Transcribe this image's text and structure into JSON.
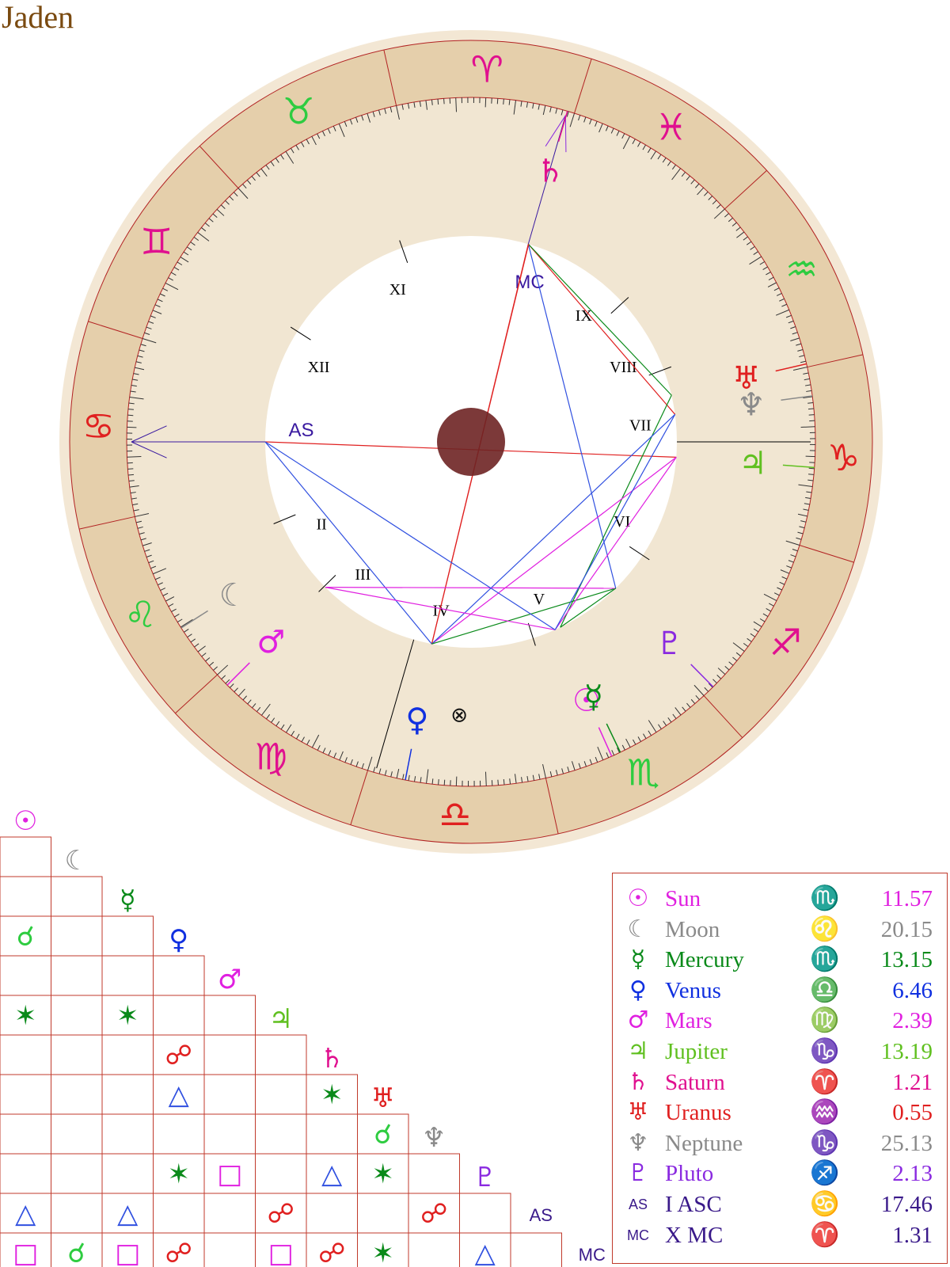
{
  "title": "Jaden",
  "wheel": {
    "asc_longitude": 107.46,
    "mc_longitude": 1.31,
    "ring_outer_color": "#f3e7d4",
    "zodiac_band_color": "#e5cfab",
    "inner_ring_color": "#f1e6d2",
    "line_color": "#b22222",
    "center_dot_color": "#6e2424",
    "signs": [
      {
        "glyph": "♈",
        "color": "#e0108f"
      },
      {
        "glyph": "♉",
        "color": "#2ecc40"
      },
      {
        "glyph": "♊",
        "color": "#e0108f"
      },
      {
        "glyph": "♋",
        "color": "#e02020"
      },
      {
        "glyph": "♌",
        "color": "#2ecc40"
      },
      {
        "glyph": "♍",
        "color": "#e0108f"
      },
      {
        "glyph": "♎",
        "color": "#e02020"
      },
      {
        "glyph": "♏",
        "color": "#2ecc40"
      },
      {
        "glyph": "♐",
        "color": "#e0108f"
      },
      {
        "glyph": "♑",
        "color": "#e02020"
      },
      {
        "glyph": "♒",
        "color": "#2ecc40"
      },
      {
        "glyph": "♓",
        "color": "#e0108f"
      }
    ],
    "houses": [
      {
        "label": "AS",
        "lon": 107.46,
        "color": "#3a1aa0"
      },
      {
        "label": "II",
        "lon": 130,
        "color": "#000000"
      },
      {
        "label": "III",
        "lon": 152,
        "color": "#000000"
      },
      {
        "label": "IV",
        "lon": 181.31,
        "color": "#000000"
      },
      {
        "label": "V",
        "lon": 215,
        "color": "#000000"
      },
      {
        "label": "VI",
        "lon": 254,
        "color": "#000000"
      },
      {
        "label": "VII",
        "lon": 287.46,
        "color": "#000000"
      },
      {
        "label": "VIII",
        "lon": 308,
        "color": "#000000"
      },
      {
        "label": "IX",
        "lon": 330,
        "color": "#000000"
      },
      {
        "label": "MC",
        "lon": 1.31,
        "color": "#3a1aa0"
      },
      {
        "label": "XI",
        "lon": 37,
        "color": "#000000"
      },
      {
        "label": "XII",
        "lon": 75,
        "color": "#000000"
      }
    ],
    "part_of_fortune": {
      "glyph": "⊗",
      "lon": 195
    }
  },
  "planets": [
    {
      "key": "sun",
      "glyph": "☉",
      "name": "Sun",
      "sign_glyph": "♏",
      "degree": "11.57",
      "lon": 221.57,
      "color": "#e020e0"
    },
    {
      "key": "moon",
      "glyph": "☾",
      "name": "Moon",
      "sign_glyph": "♌",
      "degree": "20.15",
      "lon": 140.15,
      "color": "#8a8a8a"
    },
    {
      "key": "mercury",
      "glyph": "☿",
      "name": "Mercury",
      "sign_glyph": "♏",
      "degree": "13.15",
      "lon": 223.15,
      "color": "#0a8a1a"
    },
    {
      "key": "venus",
      "glyph": "♀",
      "name": "Venus",
      "sign_glyph": "♎",
      "degree": "6.46",
      "lon": 186.46,
      "color": "#1030e0"
    },
    {
      "key": "mars",
      "glyph": "♂",
      "name": "Mars",
      "sign_glyph": "♍",
      "degree": "2.39",
      "lon": 152.39,
      "color": "#e020e0"
    },
    {
      "key": "jupiter",
      "glyph": "♃",
      "name": "Jupiter",
      "sign_glyph": "♑",
      "degree": "13.19",
      "lon": 283.19,
      "color": "#60c020"
    },
    {
      "key": "saturn",
      "glyph": "♄",
      "name": "Saturn",
      "sign_glyph": "♈",
      "degree": "1.21",
      "lon": 1.21,
      "color": "#e0108f"
    },
    {
      "key": "uranus",
      "glyph": "♅",
      "name": "Uranus",
      "sign_glyph": "♒",
      "degree": "0.55",
      "lon": 300.55,
      "color": "#e02020"
    },
    {
      "key": "neptune",
      "glyph": "♆",
      "name": "Neptune",
      "sign_glyph": "♑",
      "degree": "25.13",
      "lon": 295.13,
      "color": "#8a8a8a"
    },
    {
      "key": "pluto",
      "glyph": "♇",
      "name": "Pluto",
      "sign_glyph": "♐",
      "degree": "2.13",
      "lon": 242.13,
      "color": "#8a2ae0"
    },
    {
      "key": "asc",
      "glyph": "AS",
      "name": "I ASC",
      "sign_glyph": "♋",
      "degree": "17.46",
      "lon": 107.46,
      "color": "#3a1a8a"
    },
    {
      "key": "mc",
      "glyph": "MC",
      "name": "X MC",
      "sign_glyph": "♈",
      "degree": "1.31",
      "lon": 1.31,
      "color": "#3a1a8a"
    }
  ],
  "aspect_lines": [
    {
      "from": "asc",
      "to": "venus",
      "color": "#3050e0"
    },
    {
      "from": "asc",
      "to": "jupiter",
      "color": "#e02020"
    },
    {
      "from": "mc",
      "to": "venus",
      "color": "#e02020"
    },
    {
      "from": "mc",
      "to": "neptune",
      "color": "#e02020"
    },
    {
      "from": "mc",
      "to": "pluto",
      "color": "#3050e0"
    },
    {
      "from": "mc",
      "to": "uranus",
      "color": "#0a8a1a"
    },
    {
      "from": "saturn",
      "to": "venus",
      "color": "#e02020"
    },
    {
      "from": "uranus",
      "to": "mercury",
      "color": "#0a8a1a"
    },
    {
      "from": "venus",
      "to": "jupiter",
      "color": "#e020e0"
    },
    {
      "from": "venus",
      "to": "neptune",
      "color": "#3050e0"
    },
    {
      "from": "venus",
      "to": "pluto",
      "color": "#0a8a1a"
    },
    {
      "from": "mars",
      "to": "sun",
      "color": "#e020e0"
    },
    {
      "from": "mars",
      "to": "pluto",
      "color": "#e020e0"
    },
    {
      "from": "jupiter",
      "to": "sun",
      "color": "#e020e0"
    },
    {
      "from": "neptune",
      "to": "sun",
      "color": "#3050e0"
    },
    {
      "from": "asc",
      "to": "sun",
      "color": "#3050e0"
    },
    {
      "from": "pluto",
      "to": "mercury",
      "color": "#0a8a1a"
    }
  ],
  "aspect_grid": {
    "header_glyphs": [
      "☉",
      "☾",
      "☿",
      "♀",
      "♂",
      "♃",
      "♄",
      "♅",
      "♆",
      "♇",
      "AS",
      "MC"
    ],
    "header_colors": [
      "#e020e0",
      "#8a8a8a",
      "#0a8a1a",
      "#1030e0",
      "#e020e0",
      "#60c020",
      "#e0108f",
      "#e02020",
      "#8a8a8a",
      "#8a2ae0",
      "#3a1a8a",
      "#3a1a8a"
    ],
    "cells": [
      {
        "row": 2,
        "col": 0,
        "glyph": "☌",
        "color": "#2ecc40"
      },
      {
        "row": 4,
        "col": 0,
        "glyph": "✶",
        "color": "#0a8a1a"
      },
      {
        "row": 4,
        "col": 2,
        "glyph": "✶",
        "color": "#0a8a1a"
      },
      {
        "row": 5,
        "col": 3,
        "glyph": "☍",
        "color": "#e02020"
      },
      {
        "row": 6,
        "col": 3,
        "glyph": "△",
        "color": "#3050e0"
      },
      {
        "row": 6,
        "col": 6,
        "glyph": "✶",
        "color": "#0a8a1a"
      },
      {
        "row": 7,
        "col": 7,
        "glyph": "☌",
        "color": "#2ecc40"
      },
      {
        "row": 8,
        "col": 3,
        "glyph": "✶",
        "color": "#0a8a1a"
      },
      {
        "row": 8,
        "col": 4,
        "glyph": "□",
        "color": "#e020e0"
      },
      {
        "row": 8,
        "col": 6,
        "glyph": "△",
        "color": "#3050e0"
      },
      {
        "row": 8,
        "col": 7,
        "glyph": "✶",
        "color": "#0a8a1a"
      },
      {
        "row": 9,
        "col": 0,
        "glyph": "△",
        "color": "#3050e0"
      },
      {
        "row": 9,
        "col": 2,
        "glyph": "△",
        "color": "#3050e0"
      },
      {
        "row": 9,
        "col": 5,
        "glyph": "☍",
        "color": "#e02020"
      },
      {
        "row": 9,
        "col": 8,
        "glyph": "☍",
        "color": "#e02020"
      },
      {
        "row": 10,
        "col": 0,
        "glyph": "□",
        "color": "#e020e0"
      },
      {
        "row": 10,
        "col": 1,
        "glyph": "☌",
        "color": "#2ecc40"
      },
      {
        "row": 10,
        "col": 2,
        "glyph": "□",
        "color": "#e020e0"
      },
      {
        "row": 10,
        "col": 3,
        "glyph": "☍",
        "color": "#e02020"
      },
      {
        "row": 10,
        "col": 5,
        "glyph": "□",
        "color": "#e020e0"
      },
      {
        "row": 10,
        "col": 6,
        "glyph": "☍",
        "color": "#e02020"
      },
      {
        "row": 10,
        "col": 7,
        "glyph": "✶",
        "color": "#0a8a1a"
      },
      {
        "row": 10,
        "col": 9,
        "glyph": "△",
        "color": "#3050e0"
      }
    ]
  }
}
